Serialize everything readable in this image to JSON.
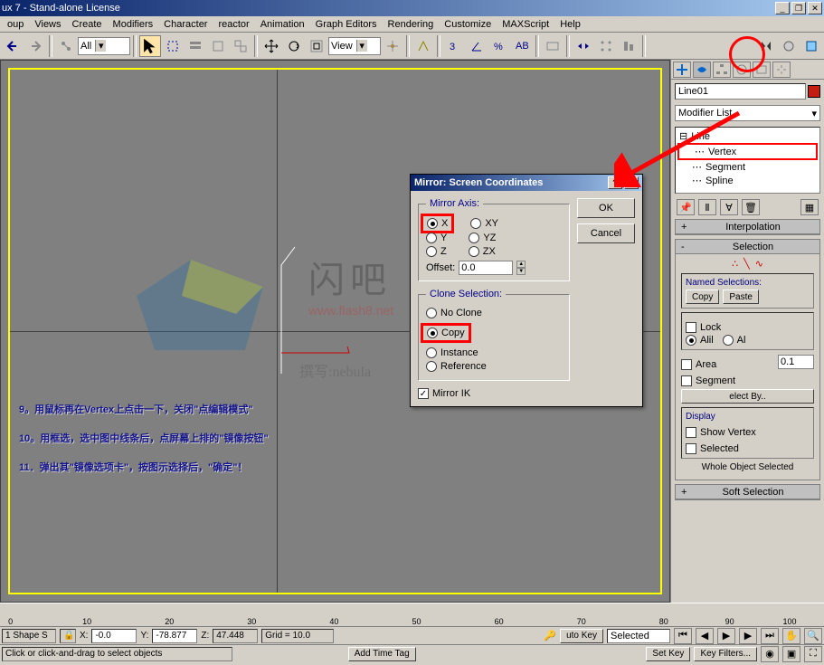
{
  "title": "ux 7  - Stand-alone License",
  "menu": [
    "oup",
    "Views",
    "Create",
    "Modifiers",
    "Character",
    "reactor",
    "Animation",
    "Graph Editors",
    "Rendering",
    "Customize",
    "MAXScript",
    "Help"
  ],
  "toolbar": {
    "combo1": "All",
    "combo2": "View"
  },
  "dialog": {
    "title": "Mirror: Screen Coordinates",
    "axis_legend": "Mirror Axis:",
    "axes": [
      "X",
      "Y",
      "Z",
      "XY",
      "YZ",
      "ZX"
    ],
    "offset_label": "Offset:",
    "offset_value": "0.0",
    "clone_legend": "Clone Selection:",
    "clone_opts": [
      "No Clone",
      "Copy",
      "Instance",
      "Reference"
    ],
    "mirror_ik": "Mirror IK",
    "ok": "OK",
    "cancel": "Cancel"
  },
  "side": {
    "objname": "Line01",
    "modlist": "Modifier List",
    "tree_root": "Line",
    "tree_items": [
      "Vertex",
      "Segment",
      "Spline"
    ],
    "rollouts": {
      "interp": "Interpolation",
      "selection": "Selection",
      "namedsel": "Named Selections:",
      "copy": "Copy",
      "paste": "Paste",
      "lock": "Lock",
      "alil": "Alil",
      "al": "Al",
      "area": "Area",
      "area_val": "0.1",
      "segment": "Segment",
      "selectby": "elect By..",
      "display": "Display",
      "showvertex": "Show Vertex",
      "selected": "Selected",
      "whole": "Whole Object Selected",
      "softsel": "Soft Selection"
    }
  },
  "status": {
    "shape": "1 Shape S",
    "x": "-0.0",
    "y": "-78.877",
    "z": "47.448",
    "grid": "Grid = 10.0",
    "autokey": "uto Key",
    "selected": "Selected",
    "setkey": "Set Key",
    "keyfilters": "Key Filters...",
    "addtag": "Add Time Tag",
    "prompt": "Click or click-and-drag to select objects"
  },
  "ticks": [
    0,
    10,
    20,
    30,
    40,
    50,
    60,
    70,
    80,
    90,
    100
  ],
  "tutorial": {
    "l1": "9。用鼠标再在Vertex上点击一下，关闭\"点编辑模式\"",
    "l2": "10。用框选，选中图中线条后，点屏幕上排的\"镜像按钮\"",
    "l3": "11．弹出其\"镜像选项卡\"，按图示选择后，\"确定\"！"
  },
  "watermark": {
    "text": "闪吧",
    "sub": "www.flash8.net",
    "by": "撰写:nebula"
  }
}
